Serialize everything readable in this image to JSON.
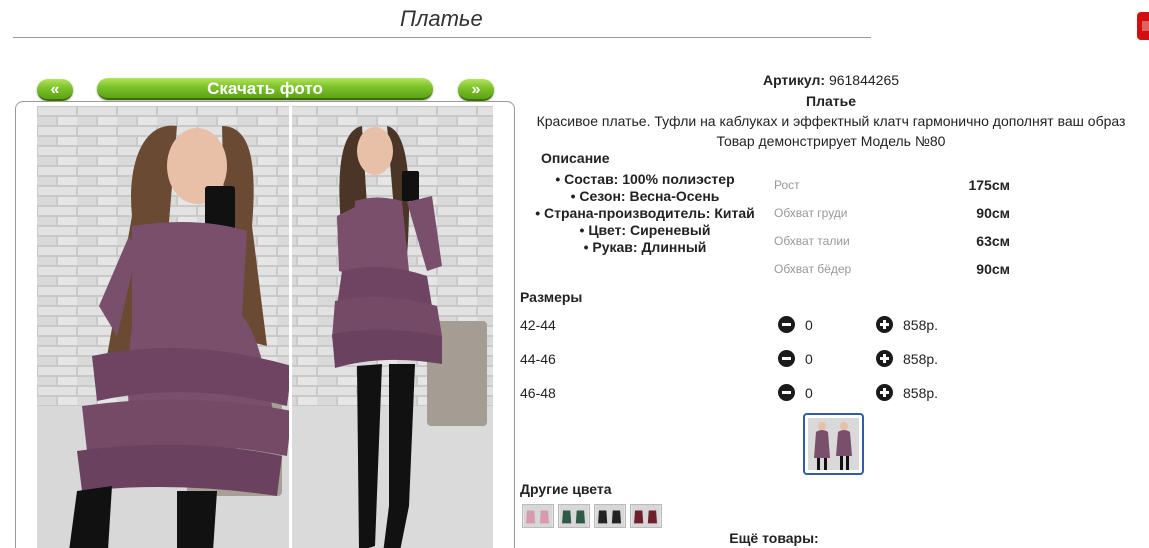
{
  "header": {
    "title": "Платье"
  },
  "gallery": {
    "prev_label": "«",
    "next_label": "»",
    "download_label": "Скачать фото"
  },
  "product": {
    "article_label": "Артикул:",
    "article_value": "961844265",
    "name": "Платье",
    "description": "Красивое платье. Туфли на каблуках и эффектный клатч гармонично дополнят ваш образ",
    "model": "Товар демонстрирует Модель №80"
  },
  "details": {
    "heading": "Описание",
    "items": [
      "Состав: 100% полиэстер",
      "Сезон: Весна-Осень",
      "Страна-производитель: Китай",
      "Цвет: Сиреневый",
      "Рукав: Длинный"
    ]
  },
  "measurements": [
    {
      "label": "Рост",
      "value": "175см"
    },
    {
      "label": "Обхват груди",
      "value": "90см"
    },
    {
      "label": "Обхват талии",
      "value": "63см"
    },
    {
      "label": "Обхват бёдер",
      "value": "90см"
    }
  ],
  "sizes": {
    "heading": "Размеры",
    "rows": [
      {
        "size": "42-44",
        "qty": "0",
        "price": "858р."
      },
      {
        "size": "44-46",
        "qty": "0",
        "price": "858р."
      },
      {
        "size": "46-48",
        "qty": "0",
        "price": "858р."
      }
    ]
  },
  "other_colors": {
    "heading": "Другие цвета"
  },
  "more_products": {
    "heading": "Ещё товары:"
  },
  "colors": {
    "accent_green": "#7bc22b",
    "close_red": "#d10f0f",
    "thumb_border": "#2f5da6",
    "dress": "#7a4f6c"
  }
}
